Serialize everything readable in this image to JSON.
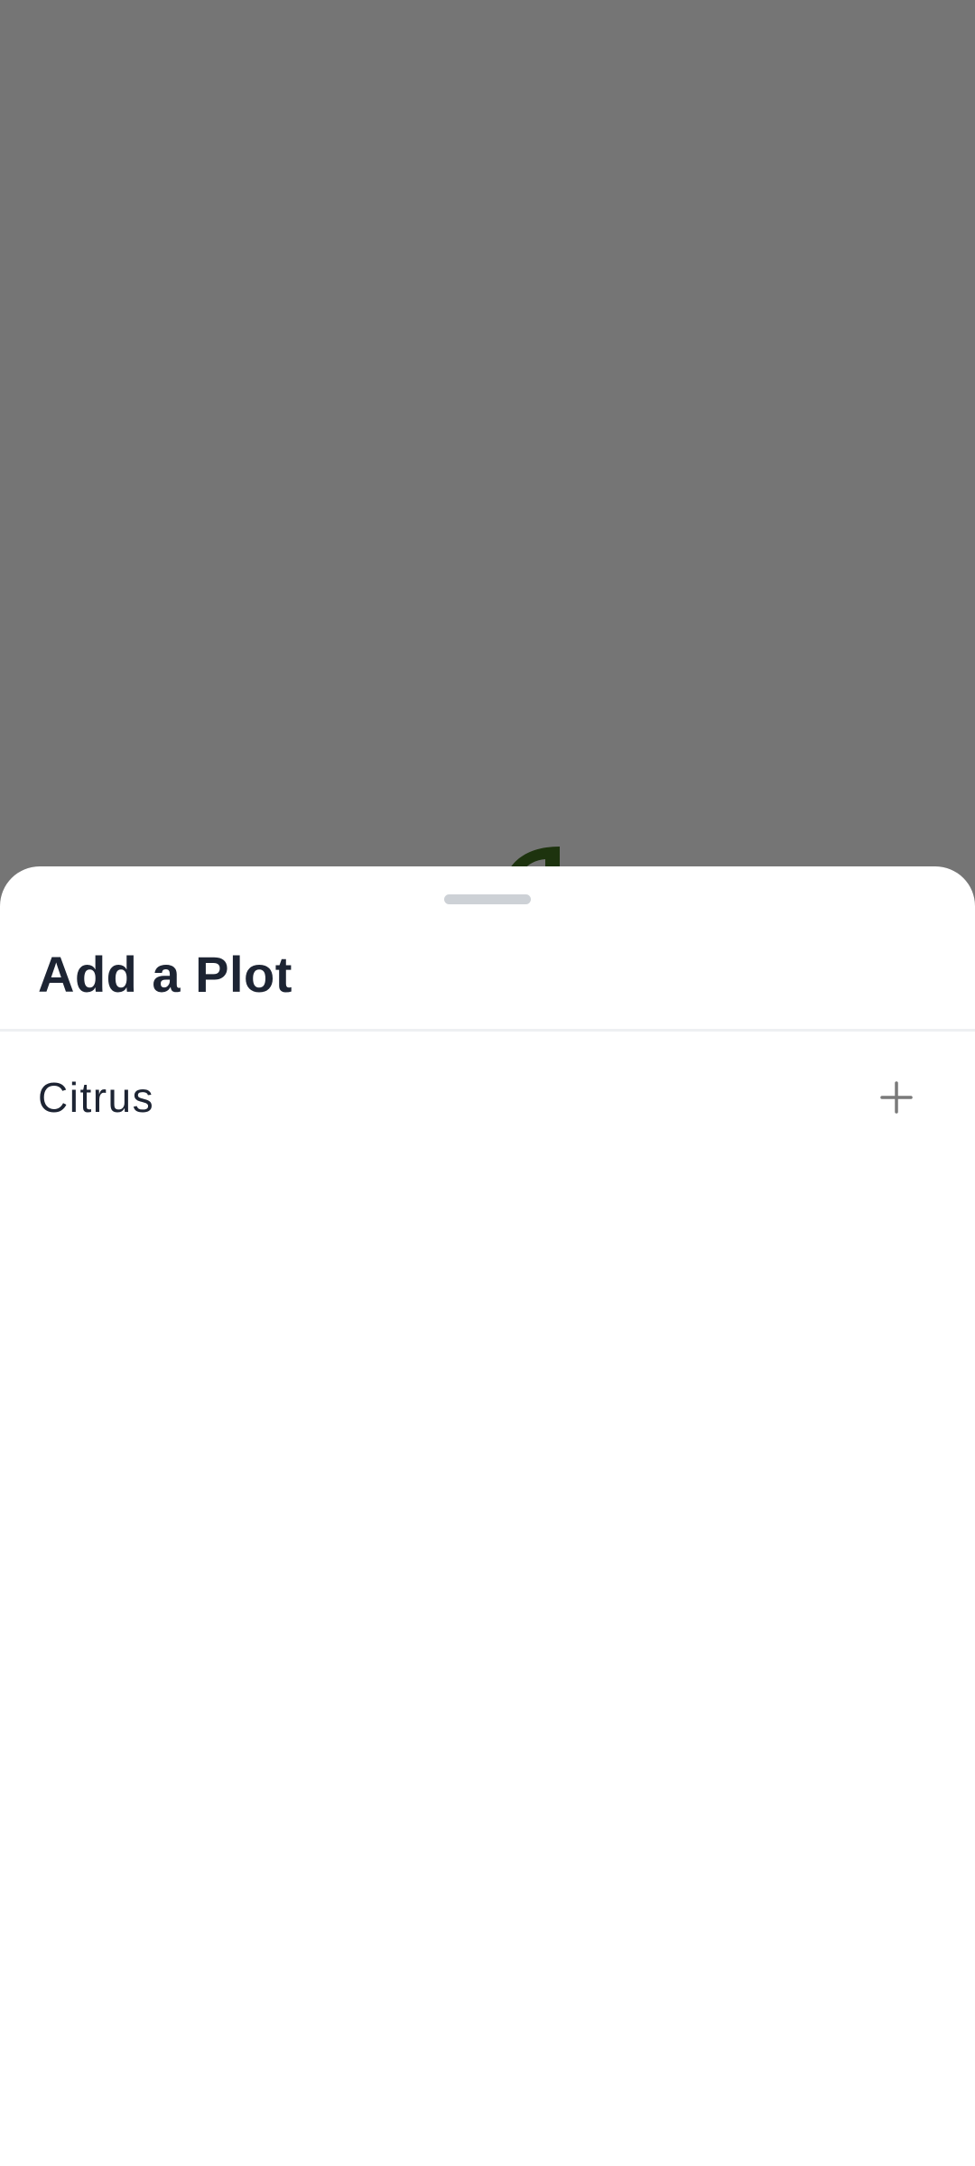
{
  "sheet": {
    "title": "Add a Plot"
  },
  "plots": [
    {
      "name": "Citrus",
      "action_icon": "plus-icon"
    }
  ],
  "colors": {
    "scrim": "#777777",
    "brand_green": "#3d6b1f",
    "title_text": "#1d2433",
    "handle": "#cdd1d6",
    "icon_gray": "#7a7a7a"
  }
}
